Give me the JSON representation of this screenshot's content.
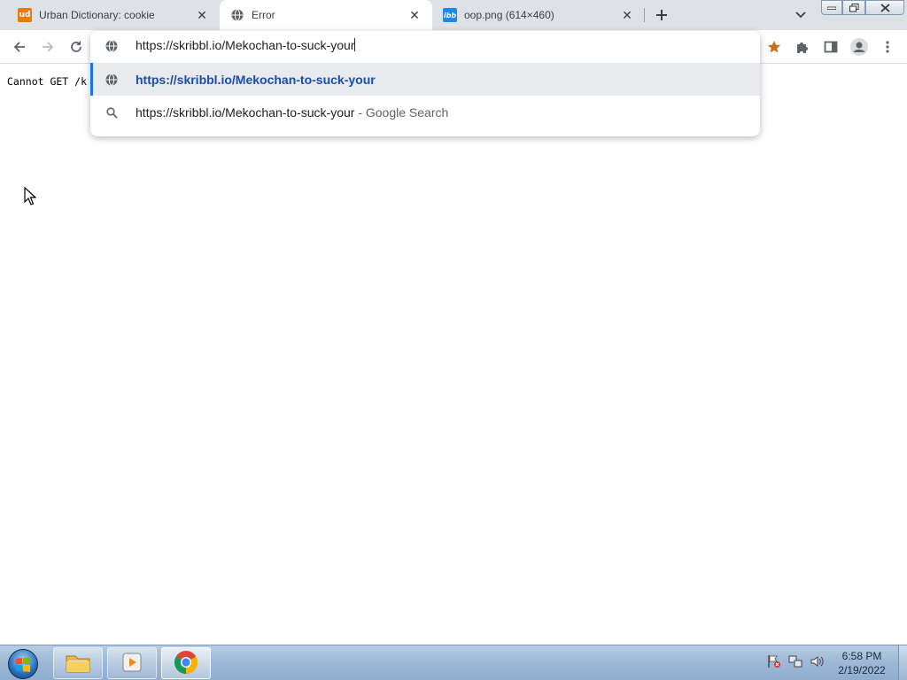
{
  "tabs": [
    {
      "title": "Urban Dictionary: cookie",
      "favicon": "urban-dictionary-icon",
      "favicon_text": "ud",
      "active": false
    },
    {
      "title": "Error",
      "favicon": "globe-icon",
      "active": true
    },
    {
      "title": "oop.png (614×460)",
      "favicon": "imgbb-icon",
      "favicon_text": "ibb",
      "active": false
    }
  ],
  "omnibox": {
    "value": "https://skribbl.io/Mekochan-to-suck-your",
    "suggestions": [
      {
        "text": "https://skribbl.io/Mekochan-to-suck-your",
        "desc": "",
        "icon": "globe-icon"
      },
      {
        "text": "https://skribbl.io/Mekochan-to-suck-your",
        "desc": " - Google Search",
        "icon": "search-icon"
      }
    ]
  },
  "page": {
    "text": "Cannot GET /k"
  },
  "taskbar": {
    "time": "6:58 PM",
    "date": "2/19/2022"
  },
  "colors": {
    "accent": "#1a73e8",
    "tabstrip": "#dee1e6",
    "bookmark_star": "#c5701b"
  }
}
